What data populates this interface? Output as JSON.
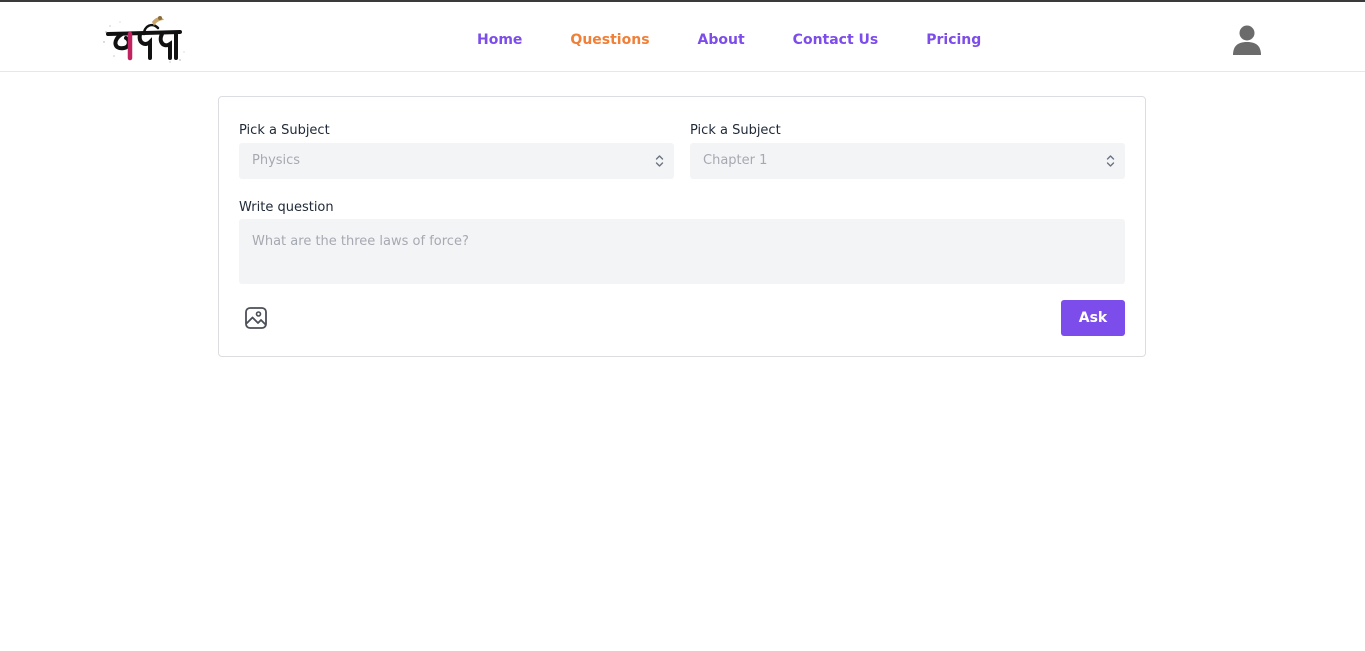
{
  "nav": {
    "logo_icon": "logo-calligraphy",
    "links": [
      {
        "label": "Home",
        "active": false
      },
      {
        "label": "Questions",
        "active": true
      },
      {
        "label": "About",
        "active": false
      },
      {
        "label": "Contact Us",
        "active": false
      },
      {
        "label": "Pricing",
        "active": false
      }
    ],
    "avatar_icon": "user-icon"
  },
  "form": {
    "subject_label": "Pick a Subject",
    "subject_value": "Physics",
    "chapter_label": "Pick a Subject",
    "chapter_value": "Chapter 1",
    "question_label": "Write question",
    "question_placeholder": "What are the three laws of force?",
    "image_icon": "image-upload-icon",
    "ask_label": "Ask"
  },
  "colors": {
    "accent": "#7c4dea",
    "active_link": "#f07f38",
    "field_bg": "#f3f4f6"
  }
}
